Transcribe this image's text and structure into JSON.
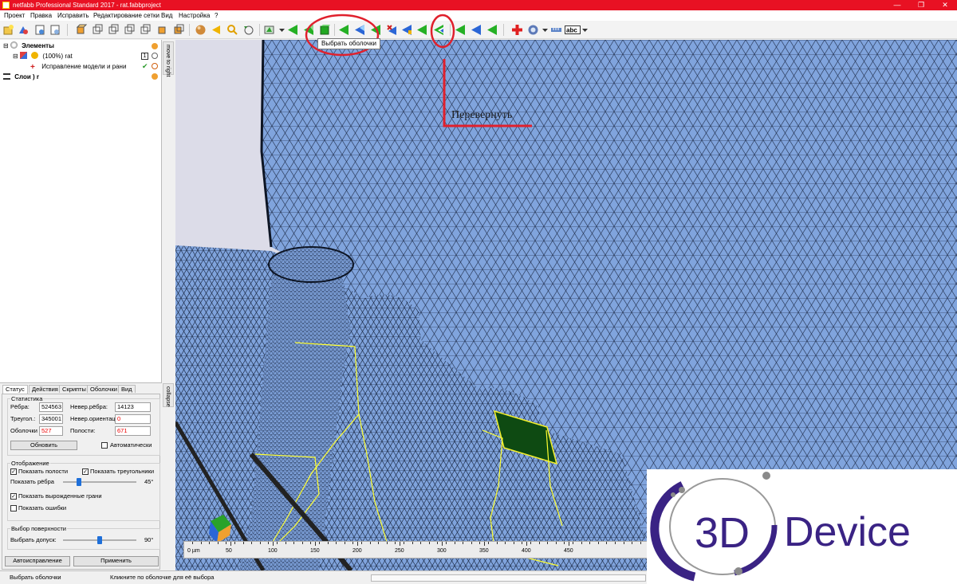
{
  "window": {
    "title": "netfabb Professional Standard 2017 - rat.fabbproject",
    "minimize": "—",
    "maximize": "❐",
    "close": "✕"
  },
  "menu": [
    "Проект",
    "Правка",
    "Исправить",
    "Редактирование сетки",
    "Вид",
    "Настройка",
    "?"
  ],
  "toolbar": {
    "tooltip": "Выбрать оболочки",
    "highlight_color": "#e0202c"
  },
  "tree": {
    "elements_label": "Элементы",
    "part_label": "(100%) rat",
    "repair_label": "Исправление модели и    рани",
    "layers_label": "Слои ) r"
  },
  "side_tabs": {
    "move_to_right": "move to right",
    "collapse": "collapse"
  },
  "panel": {
    "tabs": [
      "Статус",
      "Действия",
      "Скрипты",
      "Оболочки",
      "Вид"
    ],
    "stats": {
      "title": "Статистика",
      "edges_label": "Рёбра:",
      "edges_value": "524563",
      "bad_edges_label": "Невер.рёбра:",
      "bad_edges_value": "14123",
      "triangles_label": "Треугол.:",
      "triangles_value": "345001",
      "bad_orient_label": "Невер.ориентац",
      "bad_orient_value": "0",
      "shells_label": "Оболочки",
      "shells_value": "527",
      "holes_label": "Полости:",
      "holes_value": "671",
      "refresh_button": "Обновить",
      "auto_label": "Автоматически"
    },
    "display": {
      "title": "Отображение",
      "show_holes": "Показать полости",
      "show_triangles": "Показать треугольники",
      "show_edges": "Показать рёбра",
      "edges_angle": "45°",
      "edges_slider_fraction": 0.2,
      "show_degenerate": "Показать вырожденные грани",
      "show_errors": "Показать ошибки"
    },
    "surface": {
      "title": "Выбор поверхности",
      "tolerance_label": "Выбрать допуск:",
      "tolerance_value": "90°",
      "tolerance_slider_fraction": 0.5
    },
    "autorepair_button": "Автоисправление",
    "apply_button": "Применить"
  },
  "viewport": {
    "annotation": "Перевернуть",
    "annotation_color": "#e0202c",
    "mesh_color": "#7fa3dc",
    "ruler_unit": "0 µm",
    "ruler_ticks": [
      "50",
      "100",
      "150",
      "200",
      "250",
      "300",
      "350",
      "400",
      "450"
    ]
  },
  "statusbar": {
    "left": "Выбрать оболочки",
    "center": "Кликните по оболочке для её выбора"
  },
  "logo": {
    "text_3d": "3D",
    "text_device": "Device",
    "color": "#3a2384"
  }
}
